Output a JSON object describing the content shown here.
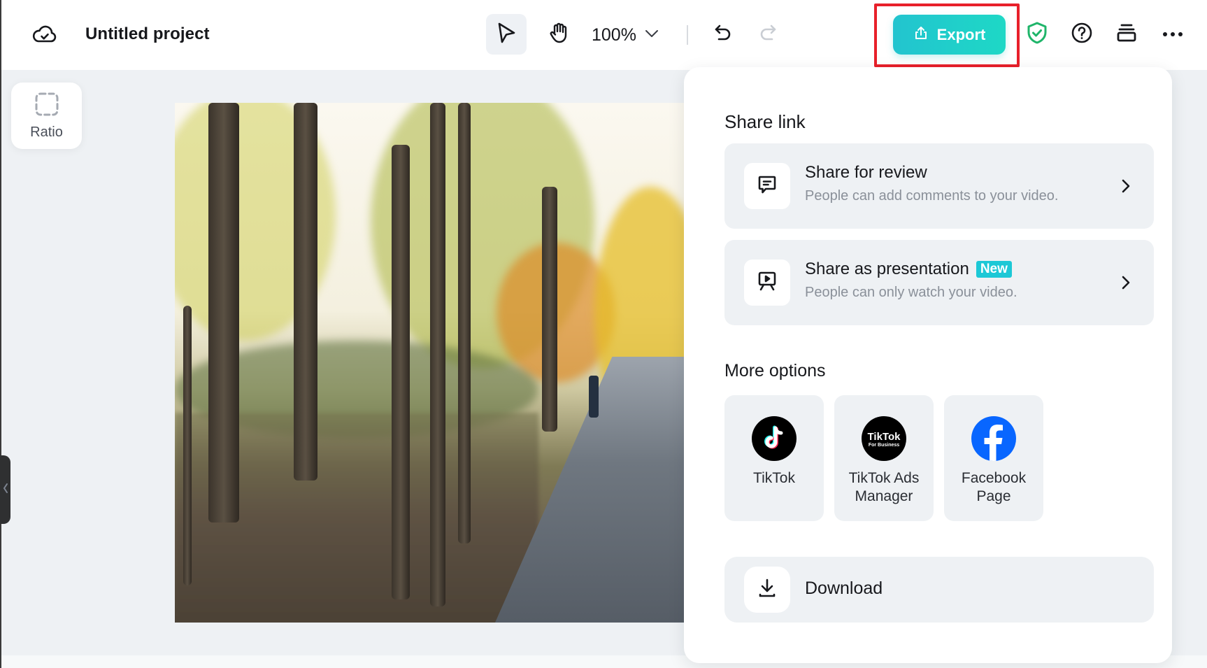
{
  "header": {
    "project_title": "Untitled project",
    "zoom_level": "100%",
    "export_label": "Export",
    "icons": {
      "save_status": "cloud-check-icon",
      "select_tool": "cursor-arrow-icon",
      "hand_tool": "hand-icon",
      "zoom_dropdown": "chevron-down-icon",
      "undo": "undo-icon",
      "redo": "redo-icon",
      "export": "upload-icon",
      "security": "shield-check-icon",
      "help": "help-circle-icon",
      "layers": "layers-icon",
      "more": "more-horizontal-icon"
    },
    "colors": {
      "export_gradient_start": "#22c4cf",
      "export_gradient_end": "#1ed8c6",
      "highlight_box": "#e8202a",
      "shield": "#1fb56a"
    }
  },
  "canvas": {
    "ratio_label": "Ratio",
    "video_description": "Autumn tree-lined road with a person walking"
  },
  "share_panel": {
    "share_link_heading": "Share link",
    "rows": [
      {
        "title": "Share for review",
        "subtitle": "People can add comments to your video.",
        "icon": "comment-icon"
      },
      {
        "title": "Share as presentation",
        "badge": "New",
        "subtitle": "People can only watch your video.",
        "icon": "presentation-icon"
      }
    ],
    "more_options_heading": "More options",
    "options": [
      {
        "label": "TikTok",
        "icon": "tiktok-logo"
      },
      {
        "label": "TikTok Ads Manager",
        "line1": "TikTok Ads",
        "line2": "Manager",
        "icon": "tiktok-business-logo",
        "logo_text_1": "TikTok",
        "logo_text_2": "For Business"
      },
      {
        "label": "Facebook Page",
        "line1": "Facebook",
        "line2": "Page",
        "icon": "facebook-logo"
      }
    ],
    "download_label": "Download",
    "colors": {
      "new_badge": "#1cc8d6",
      "facebook_blue": "#0866ff"
    }
  }
}
